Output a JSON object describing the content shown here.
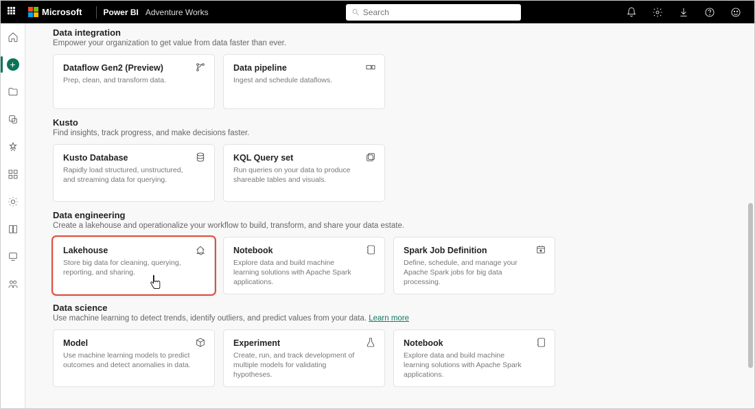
{
  "topbar": {
    "microsoft": "Microsoft",
    "product": "Power BI",
    "workspace": "Adventure Works",
    "search_placeholder": "Search"
  },
  "sections": [
    {
      "title": "Data integration",
      "sub": "Empower your organization to get value from data faster than ever.",
      "cards": [
        {
          "title": "Dataflow Gen2 (Preview)",
          "desc": "Prep, clean, and transform data.",
          "icon": "branch"
        },
        {
          "title": "Data pipeline",
          "desc": "Ingest and schedule dataflows.",
          "icon": "pipeline"
        }
      ]
    },
    {
      "title": "Kusto",
      "sub": "Find insights, track progress, and make decisions faster.",
      "cards": [
        {
          "title": "Kusto Database",
          "desc": "Rapidly load structured, unstructured, and streaming data for querying.",
          "icon": "database"
        },
        {
          "title": "KQL Query set",
          "desc": "Run queries on your data to produce shareable tables and visuals.",
          "icon": "queryset"
        }
      ]
    },
    {
      "title": "Data engineering",
      "sub": "Create a lakehouse and operationalize your workflow to build, transform, and share your data estate.",
      "cards": [
        {
          "title": "Lakehouse",
          "desc": "Store big data for cleaning, querying, reporting, and sharing.",
          "icon": "lakehouse",
          "highlight": true
        },
        {
          "title": "Notebook",
          "desc": "Explore data and build machine learning solutions with Apache Spark applications.",
          "icon": "notebook"
        },
        {
          "title": "Spark Job Definition",
          "desc": "Define, schedule, and manage your Apache Spark jobs for big data processing.",
          "icon": "sparkjob"
        }
      ]
    },
    {
      "title": "Data science",
      "sub": "Use machine learning to detect trends, identify outliers, and predict values from your data. ",
      "learn_more": "Learn more",
      "cards": [
        {
          "title": "Model",
          "desc": "Use machine learning models to predict outcomes and detect anomalies in data.",
          "icon": "model"
        },
        {
          "title": "Experiment",
          "desc": "Create, run, and track development of multiple models for validating hypotheses.",
          "icon": "experiment"
        },
        {
          "title": "Notebook",
          "desc": "Explore data and build machine learning solutions with Apache Spark applications.",
          "icon": "notebook"
        }
      ]
    }
  ]
}
